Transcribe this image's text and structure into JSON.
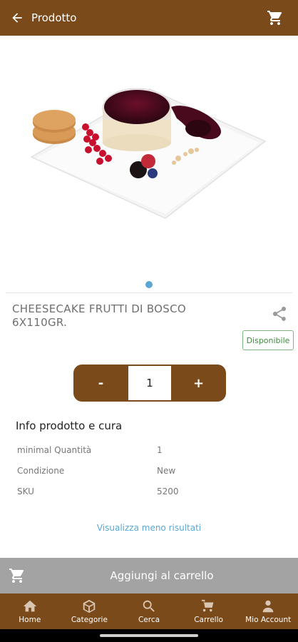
{
  "appbar": {
    "title": "Prodotto",
    "back_icon": "arrow-left-icon",
    "cart_icon": "shopping-cart-icon"
  },
  "gallery": {
    "pages": 1,
    "active_page": 1
  },
  "product": {
    "name": "CHEESECAKE FRUTTI DI BOSCO 6X110GR.",
    "availability": "Disponibile",
    "quantity": "1",
    "minus_label": "-",
    "plus_label": "+"
  },
  "info": {
    "title": "Info prodotto e cura",
    "rows": [
      {
        "key": "minimal Quantità",
        "value": "1"
      },
      {
        "key": "Condizione",
        "value": "New"
      },
      {
        "key": "SKU",
        "value": "5200"
      }
    ],
    "toggle_label": "Visualizza meno risultati"
  },
  "add_to_cart": {
    "label": "Aggiungi al carrello"
  },
  "bottom_nav": [
    {
      "label": "Home",
      "icon": "home-icon"
    },
    {
      "label": "Categorie",
      "icon": "box-icon"
    },
    {
      "label": "Cerca",
      "icon": "search-icon"
    },
    {
      "label": "Carrello",
      "icon": "cart-icon"
    },
    {
      "label": "Mio Account",
      "icon": "user-icon"
    }
  ],
  "colors": {
    "brand": "#7a4a1b",
    "link": "#5aa7d6",
    "available": "#3f8a3f",
    "add_bar": "#a3a3a3"
  }
}
